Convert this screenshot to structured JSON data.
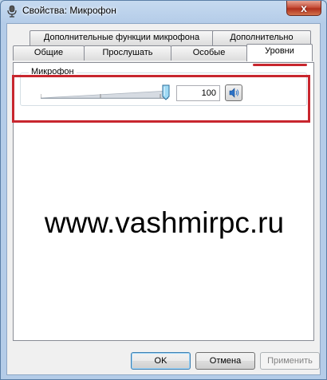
{
  "window": {
    "title": "Свойства: Микрофон",
    "close_glyph": "x"
  },
  "tabs_row1": [
    {
      "label": "Дополнительные функции микрофона"
    },
    {
      "label": "Дополнительно"
    }
  ],
  "tabs_row2": [
    {
      "label": "Общие"
    },
    {
      "label": "Прослушать"
    },
    {
      "label": "Особые"
    },
    {
      "label": "Уровни",
      "active": true
    }
  ],
  "levels": {
    "group_label": "Микрофон",
    "value": "100",
    "slider_fraction": 1.0
  },
  "watermark": "www.vashmirpc.ru",
  "buttons": {
    "ok": "OK",
    "cancel": "Отмена",
    "apply": "Применить"
  },
  "colors": {
    "highlight": "#c8262e",
    "accent": "#3c7fb1"
  },
  "icons": {
    "title": "microphone-icon",
    "speaker": "speaker-icon"
  }
}
